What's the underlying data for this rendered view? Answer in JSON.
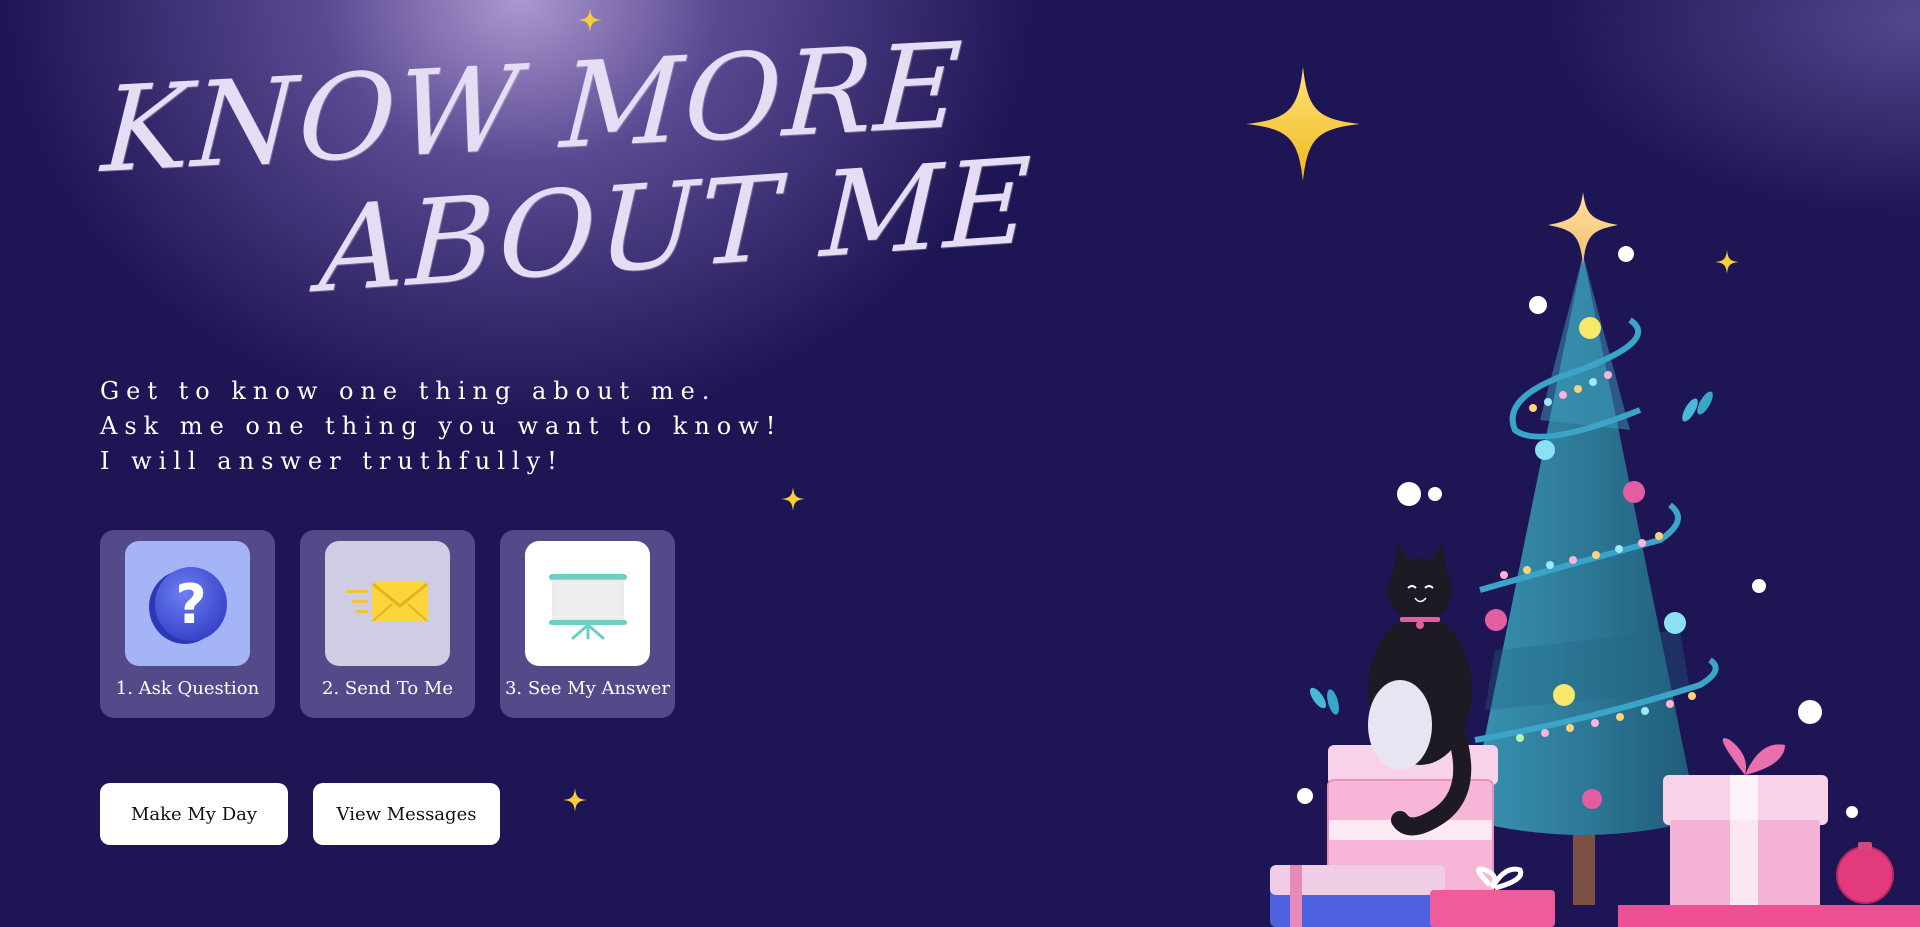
{
  "hero": {
    "title_line1": "KNOW MORE",
    "title_line2": "ABOUT ME",
    "intro": [
      "Get to know one thing about me.",
      "Ask me one thing you want to know!",
      "I will answer truthfully!"
    ]
  },
  "steps": [
    {
      "label": "1. Ask Question",
      "icon": "question-mark-icon"
    },
    {
      "label": "2. Send To Me",
      "icon": "envelope-icon"
    },
    {
      "label": "3. See My Answer",
      "icon": "presentation-board-icon"
    }
  ],
  "buttons": {
    "make_my_day": "Make My Day",
    "view_messages": "View Messages"
  },
  "decor": {
    "illustration": "christmas-tree-with-cat-and-gifts",
    "sparkles": "sparkle-icon"
  },
  "colors": {
    "background": "#1e1554",
    "title": "#e6dcf4",
    "sparkle": "#f7cd3a",
    "tree": "#2e7b99",
    "gift_pink": "#f2a6cf",
    "button_bg": "#ffffff"
  }
}
